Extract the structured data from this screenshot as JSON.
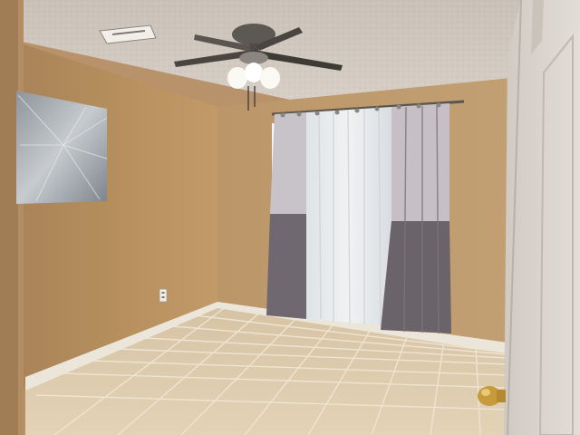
{
  "scene": {
    "description_type": "empty bedroom photo",
    "palette": {
      "wall_left": "#b68f63",
      "wall_back": "#bd9a6c",
      "ceiling": "#cfc7bd",
      "floor_tile": "#d8c4a4",
      "grout": "#e9dcc6",
      "baseboard": "#ece6da",
      "curtain_sheer": "#e6e7ea",
      "curtain_dark": "#6f6870",
      "curtain_light": "#c9c3c9",
      "door": "#d8d3cb",
      "doorknob": "#c79a3a",
      "canvas_art": "#a9adb3"
    },
    "objects": {
      "ceiling_fan": "fan-icon",
      "vent": "vent-icon",
      "outlet": "outlet-icon",
      "doorknob": "doorknob-icon"
    }
  }
}
